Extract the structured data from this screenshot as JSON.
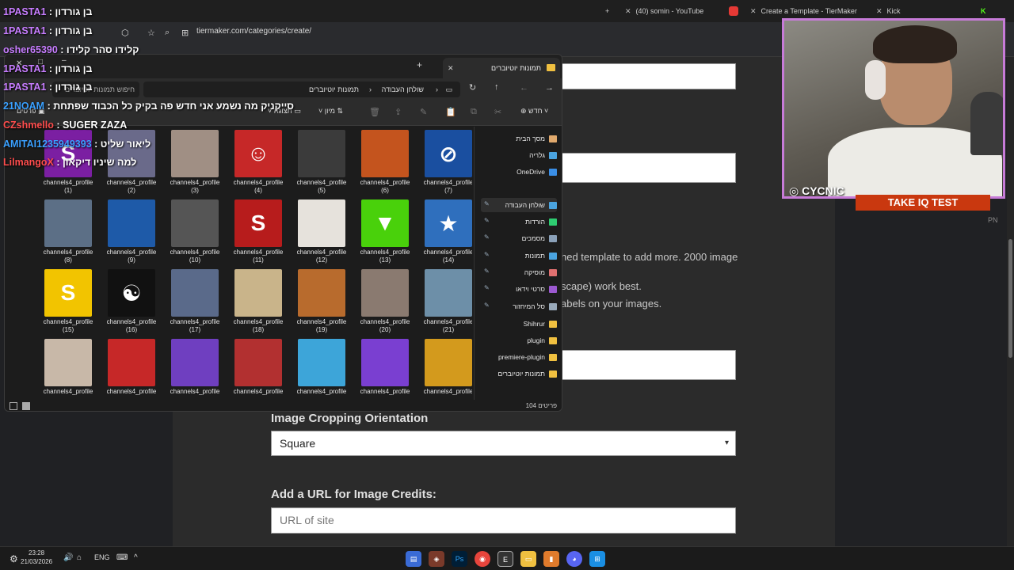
{
  "browser": {
    "tabs": [
      {
        "label": "(40) somin - YouTube"
      },
      {
        "label": "Create a Template - TierMaker"
      },
      {
        "label": "Kick"
      }
    ],
    "new_tab": "+",
    "url": "tiermaker.com/categories/create/"
  },
  "page": {
    "text_line1": "hed template to add more. 2000 image",
    "text_line2": "scape) work best.",
    "text_line3": "abels on your images.",
    "cropping_label": "Image Cropping Orientation",
    "cropping_value": "Square",
    "credits_label": "Add a URL for Image Credits:",
    "url_placeholder": "URL of site"
  },
  "explorer": {
    "tab_title": "תמונות יוטיוברים",
    "new_tab": "+",
    "breadcrumb": [
      "שולחן העבודה",
      "תמונות יוטיוברים"
    ],
    "search_placeholder": "חיפוש תמונות יוטיוברים",
    "toolbar": {
      "new": "חדש",
      "sort": "מיון",
      "view": "תצוגה",
      "details": "פרטים"
    },
    "status": "104 פריטים",
    "files": [
      {
        "name": "channels4_profile",
        "num": "(7)",
        "color": "#1a4fa0",
        "glyph": "⊘"
      },
      {
        "name": "channels4_profile",
        "num": "(6)",
        "color": "#c4541e",
        "glyph": ""
      },
      {
        "name": "channels4_profile",
        "num": "(5)",
        "color": "#3b3b3b",
        "glyph": ""
      },
      {
        "name": "channels4_profile",
        "num": "(4)",
        "color": "#c62828",
        "glyph": "☺"
      },
      {
        "name": "channels4_profile",
        "num": "(3)",
        "color": "#a08f84",
        "glyph": ""
      },
      {
        "name": "channels4_profile",
        "num": "(2)",
        "color": "#6a6a8a",
        "glyph": ""
      },
      {
        "name": "channels4_profile",
        "num": "(1)",
        "color": "#7b1fa2",
        "glyph": "S"
      },
      {
        "name": "channels4_profile",
        "num": "(14)",
        "color": "#2f6fbd",
        "glyph": "★"
      },
      {
        "name": "channels4_profile",
        "num": "(13)",
        "color": "#49d10b",
        "glyph": "▼"
      },
      {
        "name": "channels4_profile",
        "num": "(12)",
        "color": "#e6e2dc",
        "glyph": ""
      },
      {
        "name": "channels4_profile",
        "num": "(11)",
        "color": "#b71c1c",
        "glyph": "S"
      },
      {
        "name": "channels4_profile",
        "num": "(10)",
        "color": "#555",
        "glyph": ""
      },
      {
        "name": "channels4_profile",
        "num": "(9)",
        "color": "#1e5aa8",
        "glyph": ""
      },
      {
        "name": "channels4_profile",
        "num": "(8)",
        "color": "#5c6f86",
        "glyph": ""
      },
      {
        "name": "channels4_profile",
        "num": "(21)",
        "color": "#6d8fa8",
        "glyph": ""
      },
      {
        "name": "channels4_profile",
        "num": "(20)",
        "color": "#8a7a70",
        "glyph": ""
      },
      {
        "name": "channels4_profile",
        "num": "(19)",
        "color": "#b86b2d",
        "glyph": ""
      },
      {
        "name": "channels4_profile",
        "num": "(18)",
        "color": "#c9b48a",
        "glyph": ""
      },
      {
        "name": "channels4_profile",
        "num": "(17)",
        "color": "#5a6a8a",
        "glyph": ""
      },
      {
        "name": "channels4_profile",
        "num": "(16)",
        "color": "#111",
        "glyph": "☯"
      },
      {
        "name": "channels4_profile",
        "num": "(15)",
        "color": "#f2c400",
        "glyph": "S"
      },
      {
        "name": "channels4_profile",
        "num": "",
        "color": "#d39a1d",
        "glyph": ""
      },
      {
        "name": "channels4_profile",
        "num": "",
        "color": "#7a3fd1",
        "glyph": ""
      },
      {
        "name": "channels4_profile",
        "num": "",
        "color": "#3da5d9",
        "glyph": ""
      },
      {
        "name": "channels4_profile",
        "num": "",
        "color": "#b23030",
        "glyph": ""
      },
      {
        "name": "channels4_profile",
        "num": "",
        "color": "#6f3fc0",
        "glyph": ""
      },
      {
        "name": "channels4_profile",
        "num": "",
        "color": "#c62828",
        "glyph": ""
      },
      {
        "name": "channels4_profile",
        "num": "",
        "color": "#c8b8a8",
        "glyph": ""
      }
    ],
    "sidebar": [
      {
        "label": "מסך הבית",
        "color": "#e0a96d",
        "pin": false
      },
      {
        "label": "גלריה",
        "color": "#4aa3df",
        "pin": false
      },
      {
        "label": "OneDrive",
        "color": "#3a8ee6",
        "pin": false
      },
      {
        "label": "שולחן העבודה",
        "color": "#4aa3df",
        "pin": true
      },
      {
        "label": "הורדות",
        "color": "#2ecc71",
        "pin": true
      },
      {
        "label": "מסמכים",
        "color": "#8aa0b8",
        "pin": true
      },
      {
        "label": "תמונות",
        "color": "#4aa3df",
        "pin": true
      },
      {
        "label": "מוסיקה",
        "color": "#e07070",
        "pin": true
      },
      {
        "label": "סרטי וידאו",
        "color": "#9b59d0",
        "pin": true
      },
      {
        "label": "סל המיחזור",
        "color": "#9ab",
        "pin": true
      },
      {
        "label": "Shihrur",
        "color": "#f0c040",
        "pin": false
      },
      {
        "label": "plugin",
        "color": "#f0c040",
        "pin": false
      },
      {
        "label": "premiere-plugin",
        "color": "#f0c040",
        "pin": false
      },
      {
        "label": "תמונות יוטיוברים",
        "color": "#f0c040",
        "pin": false
      }
    ]
  },
  "chat": [
    {
      "user": "1PASTA1",
      "sep": " : ",
      "msg": "בן גורדון",
      "color": "#c77dff"
    },
    {
      "user": "1PASTA1",
      "sep": " : ",
      "msg": "בן גורדון",
      "color": "#c77dff"
    },
    {
      "user": "osher65390",
      "sep": " : ",
      "msg": "קלידו סהר קלידו",
      "color": "#c77dff"
    },
    {
      "user": "1PASTA1",
      "sep": " : ",
      "msg": "בן גורדון",
      "color": "#c77dff"
    },
    {
      "user": "1PASTA1",
      "sep": " : ",
      "msg": "בן גורדון",
      "color": "#c77dff"
    },
    {
      "user": "21NOAM",
      "sep": " : ",
      "msg": "סייקניק מה נשמע אני חדש פה בקיק כל הכבוד שפתחת",
      "color": "#3aa0ff"
    },
    {
      "user": "CZshmello",
      "sep": " : ",
      "msg": "SUGER ZAZA",
      "color": "#ff4d4d"
    },
    {
      "user": "AMITAI1235949393",
      "sep": " : ",
      "msg": "ליאור שליט",
      "color": "#3aa0ff"
    },
    {
      "user": "LilmangoX",
      "sep": " : ",
      "msg": "למה שיניו דיקאון",
      "color": "#ff4d4d"
    }
  ],
  "stream": {
    "handle": "CYCNIC",
    "banner": "TAKE IQ TEST",
    "corner": "PN"
  },
  "taskbar": {
    "time": "23:28",
    "date": "21/03/2026",
    "lang": "ENG"
  }
}
